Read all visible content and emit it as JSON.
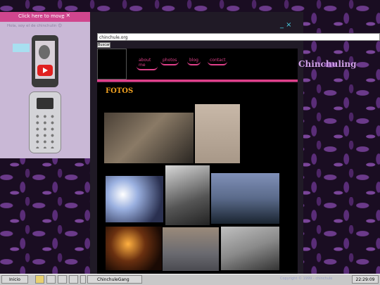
{
  "widget": {
    "move_label": "Click here to move",
    "controls": "_ ×",
    "subtitle": "Hola, soy el de chinchulin 😊"
  },
  "window": {
    "controls": "_ ×"
  },
  "browser": {
    "url": "chinchule.org",
    "search_button": "Buscar"
  },
  "site": {
    "nav": [
      "about me",
      "photos",
      "blog",
      "contact"
    ],
    "brand": "Chinchuling",
    "section_title": "FOTOS"
  },
  "taskbar": {
    "start": "Inicio",
    "task": "ChinchuleGang",
    "clock": "22:29:09",
    "copyright": "Copyright © 1999 - chinchule"
  },
  "colors": {
    "accent": "#e0408a",
    "widget_bar": "#d0468e",
    "title_orange": "#f0a020"
  }
}
